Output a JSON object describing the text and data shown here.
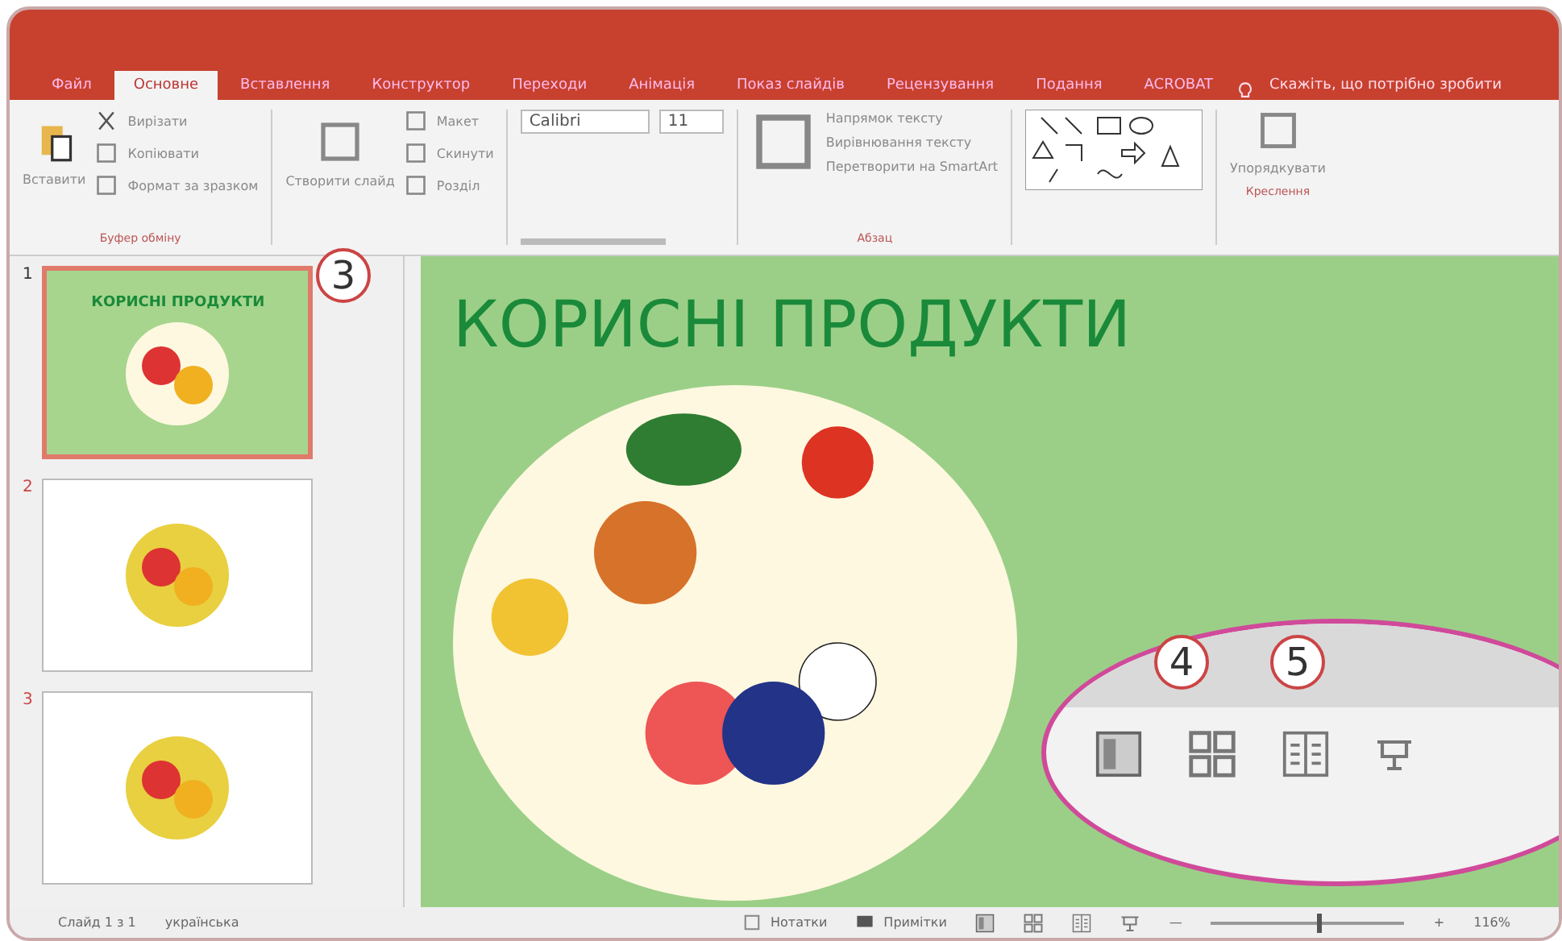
{
  "tabs": [
    {
      "label": "Файл",
      "selected": false
    },
    {
      "label": "Основне",
      "selected": true
    },
    {
      "label": "Вставлення",
      "selected": false
    },
    {
      "label": "Конструктор",
      "selected": false
    },
    {
      "label": "Переходи",
      "selected": false
    },
    {
      "label": "Анімація",
      "selected": false
    },
    {
      "label": "Показ слайдів",
      "selected": false
    },
    {
      "label": "Рецензування",
      "selected": false
    },
    {
      "label": "Подання",
      "selected": false
    },
    {
      "label": "ACROBAT",
      "selected": false
    }
  ],
  "tell_me": "Скажіть, що потрібно зробити",
  "ribbon": {
    "clipboard": {
      "paste": "Вставити",
      "cut": "Вирізати",
      "copy": "Копіювати",
      "format": "Формат за зразком",
      "group": "Буфер обміну"
    },
    "slides": {
      "new": "Створити слайд",
      "layout": "Макет",
      "reset": "Скинути",
      "section": "Розділ"
    },
    "font": {
      "name": "Calibri",
      "size": "11"
    },
    "paragraph": {
      "direction": "Напрямок тексту",
      "align": "Вирівнювання тексту",
      "smartart": "Перетворити на SmartArt",
      "group": "Абзац"
    },
    "arrange": "Упорядкувати",
    "drawing_group": "Креслення"
  },
  "thumbnails": [
    {
      "number": "1",
      "title": "КОРИСНІ ПРОДУКТИ",
      "selected": true
    },
    {
      "number": "2",
      "selected": false
    },
    {
      "number": "3",
      "selected": false
    }
  ],
  "slide": {
    "title": "КОРИСНІ ПРОДУКТИ"
  },
  "callouts": [
    "3",
    "4",
    "5"
  ],
  "status_bar": {
    "slide": "Слайд 1 з 1",
    "language": "українська",
    "notes": "Нотатки",
    "comments": "Примітки",
    "zoom_out": "—",
    "zoom_in": "+",
    "zoom": "116%",
    "level": 0.55
  }
}
